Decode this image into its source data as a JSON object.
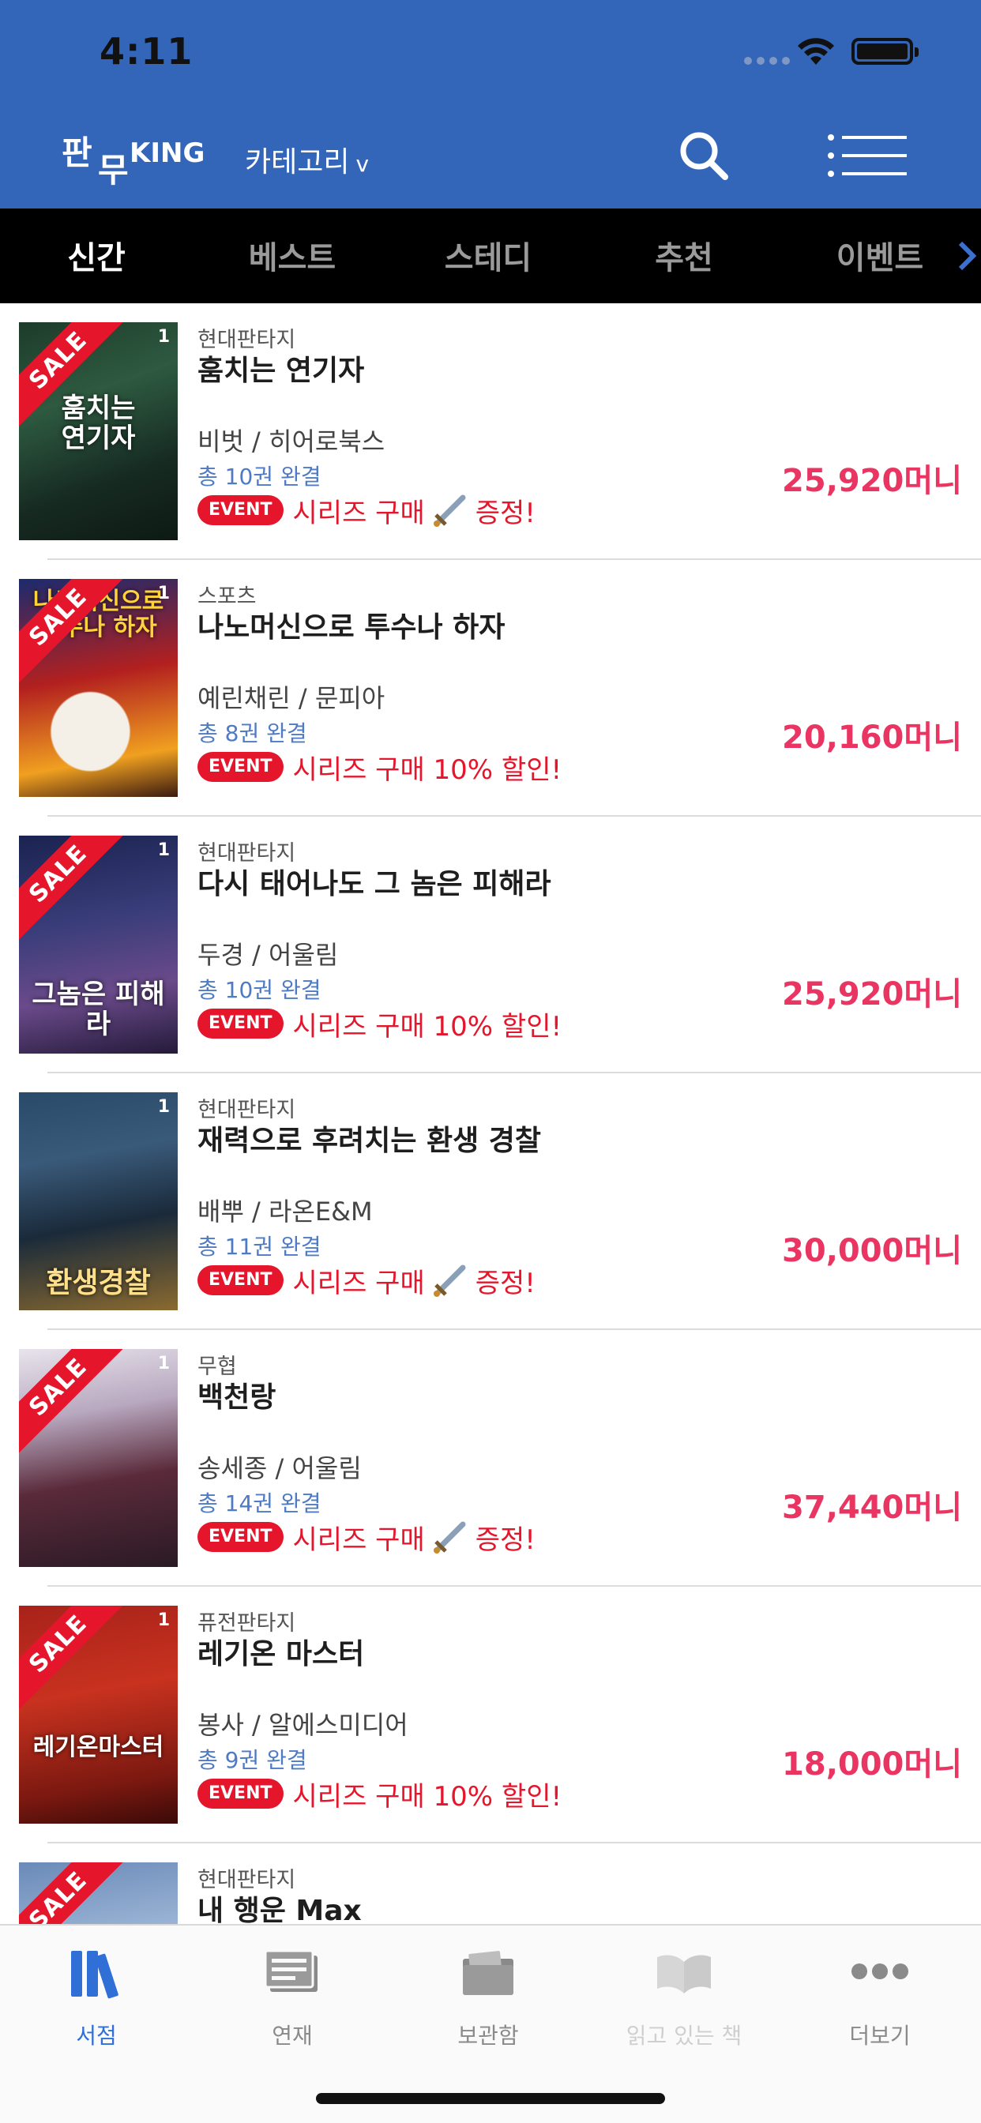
{
  "status_bar": {
    "time": "4:11"
  },
  "header": {
    "logo_part1": "판",
    "logo_part2": "무",
    "logo_king": "KING",
    "category_label": "카테고리",
    "category_chevron": "v",
    "search_icon": "search-icon",
    "menu_icon": "menu-icon",
    "bg_color": "#3366b8"
  },
  "tabs": [
    {
      "label": "신간",
      "active": true
    },
    {
      "label": "베스트",
      "active": false
    },
    {
      "label": "스테디",
      "active": false
    },
    {
      "label": "추천",
      "active": false
    },
    {
      "label": "이벤트",
      "active": false
    }
  ],
  "sale_label": "SALE",
  "event_badge": "EVENT",
  "books": [
    {
      "genre": "현대판타지",
      "title": "훔치는 연기자",
      "author": "비벗 / 히어로북스",
      "volumes": "총 10권 완결",
      "event_text_before": "시리즈 구매",
      "event_text_after": "증정!",
      "event_has_icon": true,
      "price": "25,920",
      "sale": true,
      "cover_num": "1",
      "cover_text": ""
    },
    {
      "genre": "스포츠",
      "title": "나노머신으로 투수나 하자",
      "author": "예린채린 / 문피아",
      "volumes": "총 8권 완결",
      "event_text_before": "시리즈 구매 10% 할인!",
      "event_text_after": "",
      "event_has_icon": false,
      "price": "20,160",
      "sale": true,
      "cover_num": "1",
      "cover_text": ""
    },
    {
      "genre": "현대판타지",
      "title": "다시 태어나도 그 놈은 피해라",
      "author": "두경 / 어울림",
      "volumes": "총 10권 완결",
      "event_text_before": "시리즈 구매 10% 할인!",
      "event_text_after": "",
      "event_has_icon": false,
      "price": "25,920",
      "sale": true,
      "cover_num": "1",
      "cover_text": ""
    },
    {
      "genre": "현대판타지",
      "title": "재력으로 후려치는 환생 경찰",
      "author": "배뿌 / 라온E&M",
      "volumes": "총 11권 완결",
      "event_text_before": "시리즈 구매",
      "event_text_after": "증정!",
      "event_has_icon": true,
      "price": "30,000",
      "sale": false,
      "cover_num": "1",
      "cover_text": ""
    },
    {
      "genre": "무협",
      "title": "백천랑",
      "author": "송세종 / 어울림",
      "volumes": "총 14권 완결",
      "event_text_before": "시리즈 구매",
      "event_text_after": "증정!",
      "event_has_icon": true,
      "price": "37,440",
      "sale": true,
      "cover_num": "1",
      "cover_text": ""
    },
    {
      "genre": "퓨전판타지",
      "title": "레기온 마스터",
      "author": "봉사 / 알에스미디어",
      "volumes": "총 9권 완결",
      "event_text_before": "시리즈 구매 10% 할인!",
      "event_text_after": "",
      "event_has_icon": false,
      "price": "18,000",
      "sale": true,
      "cover_num": "1",
      "cover_text": ""
    },
    {
      "genre": "현대판타지",
      "title": "내 행운 Max",
      "author": "",
      "volumes": "",
      "event_text_before": "",
      "event_text_after": "",
      "event_has_icon": false,
      "price": "",
      "sale": true,
      "cover_num": "",
      "cover_text": ""
    }
  ],
  "price_unit": "머니",
  "bottom_nav": [
    {
      "label": "서점",
      "icon": "bookshelf-icon",
      "state": "active"
    },
    {
      "label": "연재",
      "icon": "newspaper-icon",
      "state": "normal"
    },
    {
      "label": "보관함",
      "icon": "folder-icon",
      "state": "normal"
    },
    {
      "label": "읽고 있는 책",
      "icon": "open-book-icon",
      "state": "dim"
    },
    {
      "label": "더보기",
      "icon": "more-icon",
      "state": "normal"
    }
  ],
  "colors": {
    "accent_blue": "#3366b8",
    "sale_red": "#e5162b",
    "price_pink": "#ea3462",
    "volume_blue": "#4e7bc4",
    "nav_active": "#2f6fd6"
  }
}
